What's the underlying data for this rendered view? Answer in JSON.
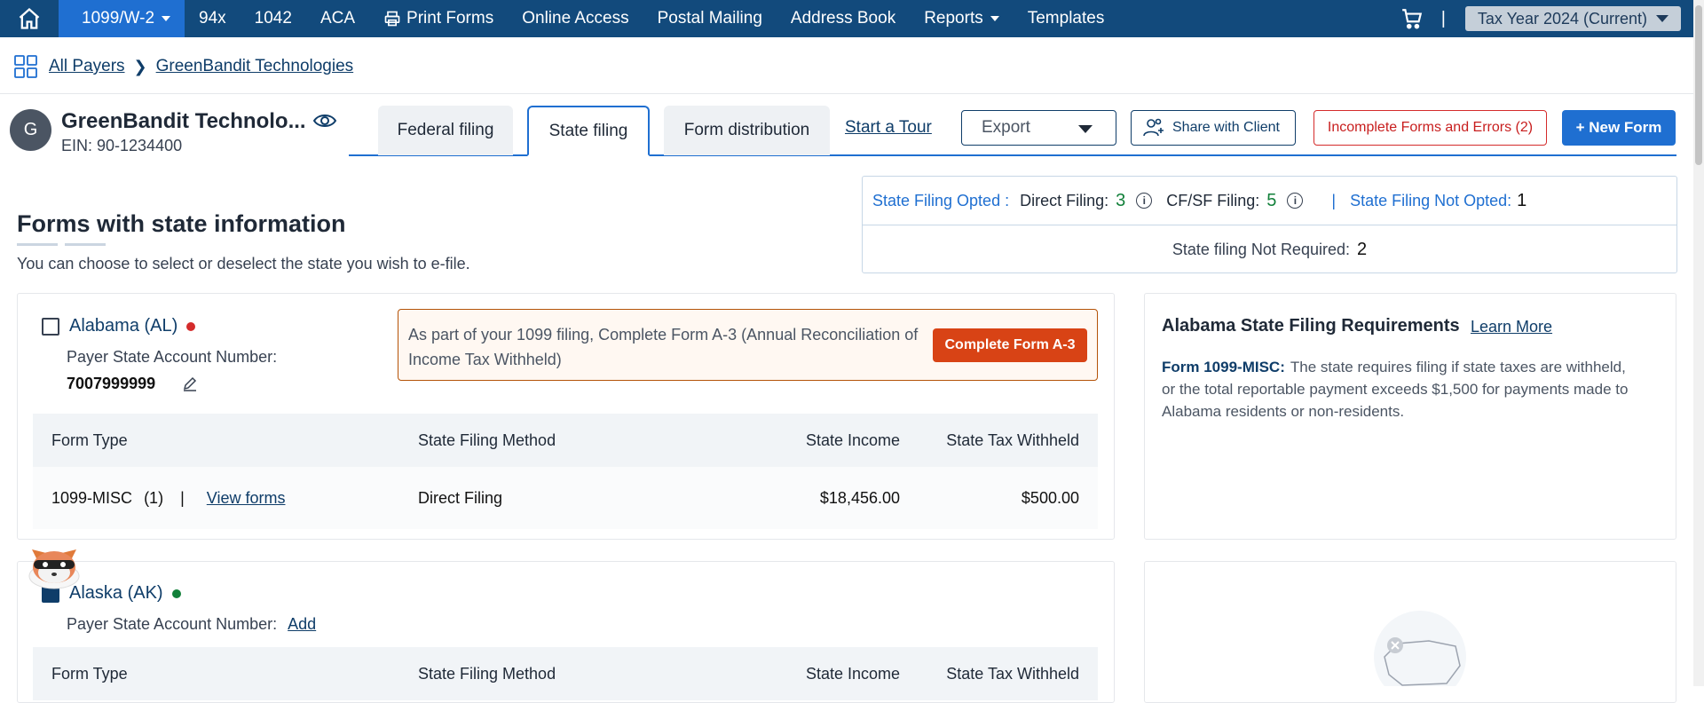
{
  "nav": {
    "items": [
      {
        "label": "1099/W-2",
        "dropdown": true,
        "active": true
      },
      {
        "label": "94x"
      },
      {
        "label": "1042"
      },
      {
        "label": "ACA"
      },
      {
        "label": "Print Forms",
        "icon": "printer-icon"
      },
      {
        "label": "Online Access"
      },
      {
        "label": "Postal Mailing"
      },
      {
        "label": "Address Book"
      },
      {
        "label": "Reports",
        "dropdown": true
      },
      {
        "label": "Templates"
      }
    ],
    "separator": "|",
    "tax_year": "Tax Year 2024 (Current)"
  },
  "breadcrumb": {
    "root": "All Payers",
    "current": "GreenBandit Technologies"
  },
  "payer": {
    "initial": "G",
    "name": "GreenBandit Technolo...",
    "ein": "EIN: 90-1234400"
  },
  "tabs": [
    {
      "label": "Federal filing"
    },
    {
      "label": "State filing",
      "active": true
    },
    {
      "label": "Form distribution"
    }
  ],
  "toolbar": {
    "tour": "Start a Tour",
    "export": "Export",
    "share": "Share with Client",
    "errors": "Incomplete Forms and Errors (2)",
    "new_form": "+ New Form"
  },
  "section": {
    "title": "Forms with state information",
    "subtitle": "You can choose to select or deselect the state you wish to e-file."
  },
  "status": {
    "opted_label": "State Filing Opted :",
    "direct_label": "Direct Filing:",
    "direct_count": "3",
    "cfsf_label": "CF/SF Filing:",
    "cfsf_count": "5",
    "not_opted_label": "State Filing Not Opted:",
    "not_opted_count": "1",
    "not_required_label": "State filing Not Required:",
    "not_required_count": "2"
  },
  "alabama": {
    "name": "Alabama (AL)",
    "dot_color": "#d42b2b",
    "acct_label": "Payer State Account Number:",
    "acct_number": "7007999999",
    "notice": "As part of your 1099 filing, Complete Form A-3 (Annual Reconciliation of Income Tax Withheld)",
    "notice_button": "Complete Form A-3",
    "table": {
      "headers": [
        "Form Type",
        "State Filing Method",
        "State Income",
        "State Tax Withheld"
      ],
      "row": {
        "form": "1099-MISC",
        "count": "(1)",
        "separator": "|",
        "link": "View forms",
        "method": "Direct Filing",
        "income": "$18,456.00",
        "withheld": "$500.00"
      }
    }
  },
  "requirements": {
    "title": "Alabama State Filing Requirements",
    "learn_more": "Learn More",
    "form": "Form 1099-MISC:",
    "text": "The state requires filing if state taxes are withheld, or the total reportable payment exceeds $1,500 for payments made to Alabama residents or non-residents."
  },
  "alaska": {
    "name": "Alaska (AK)",
    "dot_color": "#12803a",
    "acct_label": "Payer State Account Number:",
    "add": "Add",
    "table": {
      "headers": [
        "Form Type",
        "State Filing Method",
        "State Income",
        "State Tax Withheld"
      ]
    }
  }
}
